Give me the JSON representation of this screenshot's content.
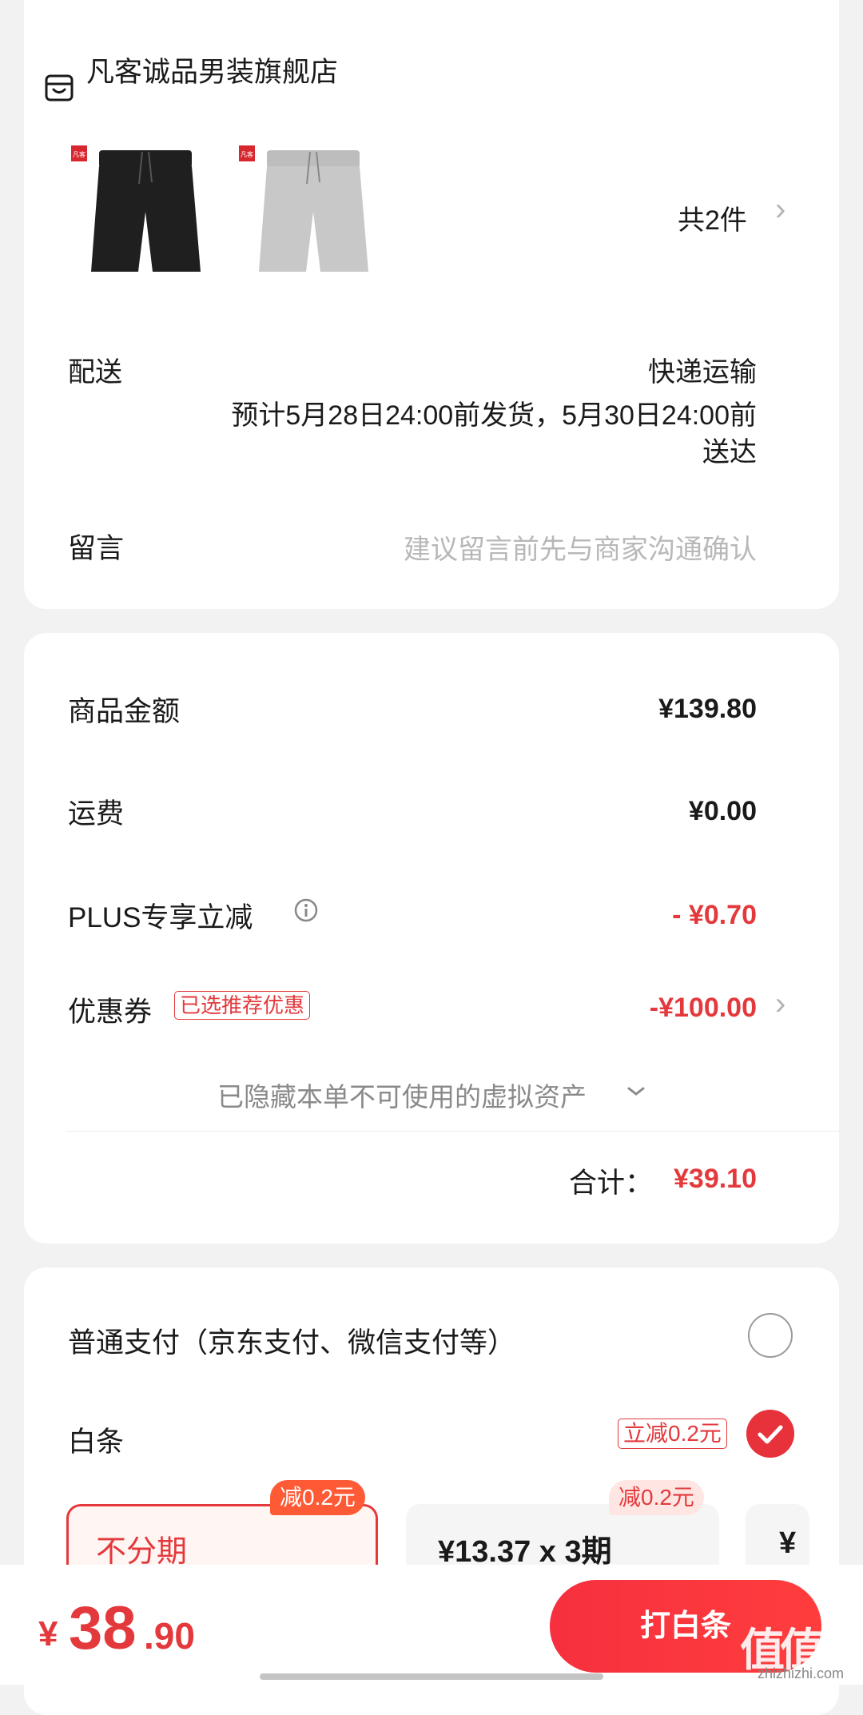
{
  "store": {
    "name": "凡客诚品男装旗舰店",
    "item_count": "共2件",
    "products": [
      {
        "tag": "凡客诚品",
        "color": "#1f1f1f"
      },
      {
        "tag": "凡客诚品",
        "color": "#c8c8c8"
      }
    ]
  },
  "delivery": {
    "label": "配送",
    "method": "快递运输",
    "estimate_line1": "预计5月28日24:00前发货，5月30日24:00前",
    "estimate_line2": "送达"
  },
  "message": {
    "label": "留言",
    "placeholder": "建议留言前先与商家沟通确认"
  },
  "amounts": {
    "goods_label": "商品金额",
    "goods_value": "¥139.80",
    "shipping_label": "运费",
    "shipping_value": "¥0.00",
    "plus_label": "PLUS专享立减",
    "plus_value": "- ¥0.70",
    "coupon_label": "优惠券",
    "coupon_badge": "已选推荐优惠",
    "coupon_value": "-¥100.00",
    "hidden_assets": "已隐藏本单不可使用的虚拟资产",
    "total_label": "合计：",
    "total_value": "¥39.10"
  },
  "payment": {
    "normal_label": "普通支付（京东支付、微信支付等）",
    "baitiao_label": "白条",
    "baitiao_tag": "立减0.2元",
    "options": [
      {
        "label": "不分期",
        "tag": "减0.2元"
      },
      {
        "label": "¥13.37 x 3期",
        "tag": "减0.2元"
      },
      {
        "label": "¥"
      }
    ]
  },
  "bottom": {
    "currency": "¥",
    "price_int": "38",
    "price_dec": ".90",
    "pay_button": "打白条",
    "watermark": "值值值",
    "watermark_sub": "zhizhizhi.com"
  },
  "colors": {
    "accent": "#e4393c",
    "background": "#f2f2f2"
  }
}
